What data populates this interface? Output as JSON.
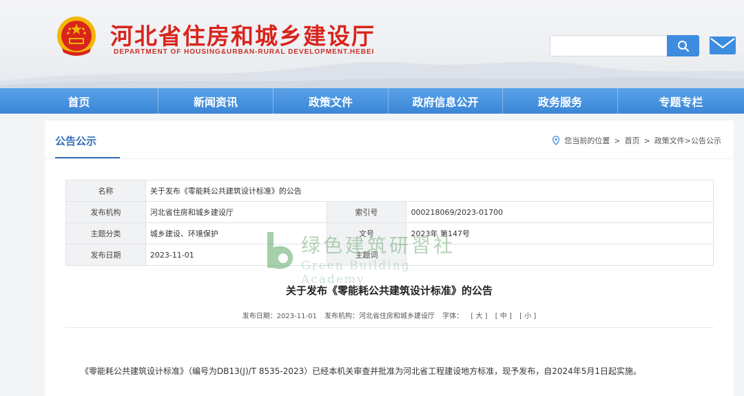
{
  "header": {
    "title": "河北省住房和城乡建设厅",
    "subtitle": "DEPARTMENT OF HOUSING&URBAN-RURAL DEVELOPMENT.HEBEI",
    "search_placeholder": ""
  },
  "nav": [
    {
      "label": "首页"
    },
    {
      "label": "新闻资讯"
    },
    {
      "label": "政策文件"
    },
    {
      "label": "政府信息公开"
    },
    {
      "label": "政务服务"
    },
    {
      "label": "专题专栏"
    }
  ],
  "panel": {
    "tab": "公告公示",
    "breadcrumb": {
      "prefix": "您当前的位置",
      "sep": ">",
      "home": "首页",
      "section": "政策文件>公告公示"
    }
  },
  "meta_table": {
    "name_label": "名称",
    "name_value": "关于发布《零能耗公共建筑设计标准》的公告",
    "org_label": "发布机构",
    "org_value": "河北省住房和城乡建设厅",
    "index_label": "索引号",
    "index_value": "000218069/2023-01700",
    "topic_label": "主题分类",
    "topic_value": "城乡建设、环境保护",
    "docno_label": "文号",
    "docno_value": "2023年 第147号",
    "date_label": "发布日期",
    "date_value": "2023-11-01",
    "keyword_label": "主题词",
    "keyword_value": ""
  },
  "document": {
    "title": "关于发布《零能耗公共建筑设计标准》的公告",
    "date_line": "发布日期：2023-11-01",
    "org_line": "发布机构：河北省住房和城乡建设厅",
    "font_label": "字体：",
    "font_large": "[ 大 ]",
    "font_medium": "[ 中 ]",
    "font_small": "[ 小 ]",
    "body": "《零能耗公共建筑设计标准》（编号为DB13(J)/T 8535-2023）已经本机关审查并批准为河北省工程建设地方标准，现予发布，自2024年5月1日起实施。"
  },
  "watermark": {
    "cn": "绿色建筑研習社",
    "en": "Green Building Academy"
  },
  "colors": {
    "brand_red": "#d9241c",
    "nav_blue": "#3a86d6",
    "accent_blue": "#2f6fb8",
    "watermark_green": "#78b07e"
  },
  "icons": [
    "national-emblem",
    "search-icon",
    "mail-icon",
    "location-pin-icon",
    "watermark-logo"
  ]
}
